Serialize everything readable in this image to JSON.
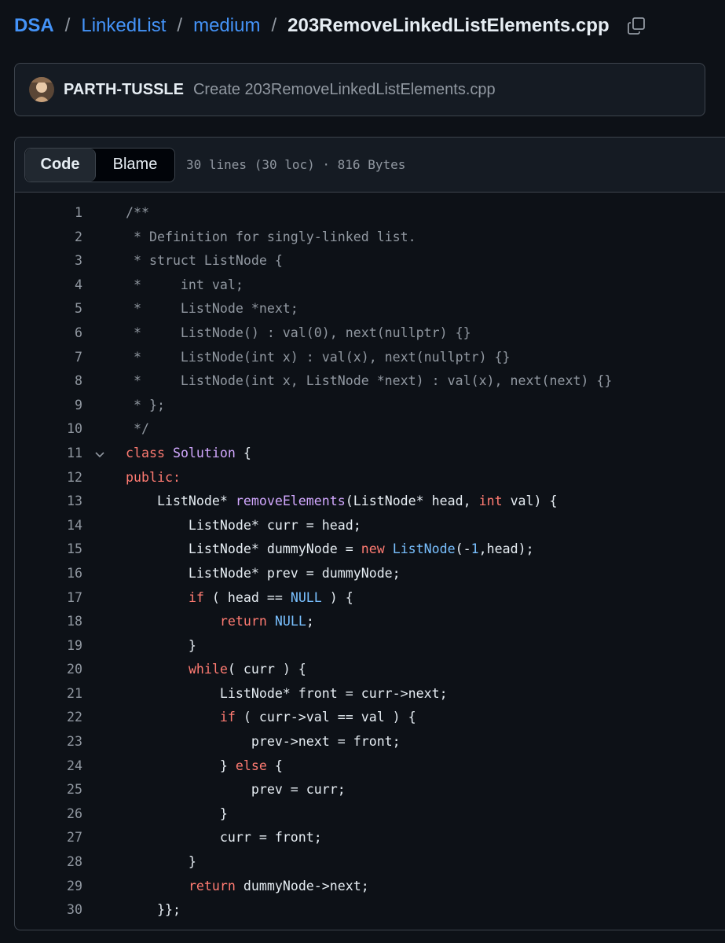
{
  "breadcrumb": {
    "repo": "DSA",
    "folder1": "LinkedList",
    "folder2": "medium",
    "file": "203RemoveLinkedListElements.cpp",
    "separator": "/"
  },
  "icons": {
    "copy": "copy-icon",
    "fold": "chevron-down-icon",
    "avatar": "user-avatar"
  },
  "commit": {
    "author": "PARTH-TUSSLE",
    "message": "Create 203RemoveLinkedListElements.cpp"
  },
  "file_header": {
    "code_tab": "Code",
    "blame_tab": "Blame",
    "stats": "30 lines (30 loc) · 816 Bytes"
  },
  "colors": {
    "background": "#0d1117",
    "link": "#4493f8",
    "comment": "#9198a1",
    "keyword": "#ff7b72",
    "function": "#d2a8ff",
    "constant": "#79c0ff"
  },
  "code": {
    "lines": [
      {
        "n": "1",
        "t": [
          [
            "c",
            "/**"
          ]
        ]
      },
      {
        "n": "2",
        "t": [
          [
            "c",
            " * Definition for singly-linked list."
          ]
        ]
      },
      {
        "n": "3",
        "t": [
          [
            "c",
            " * struct ListNode {"
          ]
        ]
      },
      {
        "n": "4",
        "t": [
          [
            "c",
            " *     int val;"
          ]
        ]
      },
      {
        "n": "5",
        "t": [
          [
            "c",
            " *     ListNode *next;"
          ]
        ]
      },
      {
        "n": "6",
        "t": [
          [
            "c",
            " *     ListNode() : val(0), next(nullptr) {}"
          ]
        ]
      },
      {
        "n": "7",
        "t": [
          [
            "c",
            " *     ListNode(int x) : val(x), next(nullptr) {}"
          ]
        ]
      },
      {
        "n": "8",
        "t": [
          [
            "c",
            " *     ListNode(int x, ListNode *next) : val(x), next(next) {}"
          ]
        ]
      },
      {
        "n": "9",
        "t": [
          [
            "c",
            " * };"
          ]
        ]
      },
      {
        "n": "10",
        "t": [
          [
            "c",
            " */"
          ]
        ]
      },
      {
        "n": "11",
        "fold": true,
        "t": [
          [
            "k",
            "class"
          ],
          [
            "p",
            " "
          ],
          [
            "f",
            "Solution"
          ],
          [
            "p",
            " {"
          ]
        ]
      },
      {
        "n": "12",
        "t": [
          [
            "k",
            "public:"
          ]
        ]
      },
      {
        "n": "13",
        "t": [
          [
            "p",
            "    ListNode* "
          ],
          [
            "f",
            "removeElements"
          ],
          [
            "p",
            "(ListNode* head, "
          ],
          [
            "k",
            "int"
          ],
          [
            "p",
            " val) {"
          ]
        ]
      },
      {
        "n": "14",
        "t": [
          [
            "p",
            "        ListNode* curr = head;"
          ]
        ]
      },
      {
        "n": "15",
        "t": [
          [
            "p",
            "        ListNode* dummyNode = "
          ],
          [
            "k",
            "new"
          ],
          [
            "p",
            " "
          ],
          [
            "y",
            "ListNode"
          ],
          [
            "p",
            "(-"
          ],
          [
            "y",
            "1"
          ],
          [
            "p",
            ",head);"
          ]
        ]
      },
      {
        "n": "16",
        "t": [
          [
            "p",
            "        ListNode* prev = dummyNode;"
          ]
        ]
      },
      {
        "n": "17",
        "t": [
          [
            "p",
            "        "
          ],
          [
            "k",
            "if"
          ],
          [
            "p",
            " ( head == "
          ],
          [
            "y",
            "NULL"
          ],
          [
            "p",
            " ) {"
          ]
        ]
      },
      {
        "n": "18",
        "t": [
          [
            "p",
            "            "
          ],
          [
            "k",
            "return"
          ],
          [
            "p",
            " "
          ],
          [
            "y",
            "NULL"
          ],
          [
            "p",
            ";"
          ]
        ]
      },
      {
        "n": "19",
        "t": [
          [
            "p",
            "        }"
          ]
        ]
      },
      {
        "n": "20",
        "t": [
          [
            "p",
            "        "
          ],
          [
            "k",
            "while"
          ],
          [
            "p",
            "( curr ) {"
          ]
        ]
      },
      {
        "n": "21",
        "t": [
          [
            "p",
            "            ListNode* front = curr->next;"
          ]
        ]
      },
      {
        "n": "22",
        "t": [
          [
            "p",
            "            "
          ],
          [
            "k",
            "if"
          ],
          [
            "p",
            " ( curr->val == val ) {"
          ]
        ]
      },
      {
        "n": "23",
        "t": [
          [
            "p",
            "                prev->next = front;"
          ]
        ]
      },
      {
        "n": "24",
        "t": [
          [
            "p",
            "            } "
          ],
          [
            "k",
            "else"
          ],
          [
            "p",
            " {"
          ]
        ]
      },
      {
        "n": "25",
        "t": [
          [
            "p",
            "                prev = curr;"
          ]
        ]
      },
      {
        "n": "26",
        "t": [
          [
            "p",
            "            }"
          ]
        ]
      },
      {
        "n": "27",
        "t": [
          [
            "p",
            "            curr = front;"
          ]
        ]
      },
      {
        "n": "28",
        "t": [
          [
            "p",
            "        }"
          ]
        ]
      },
      {
        "n": "29",
        "t": [
          [
            "p",
            "        "
          ],
          [
            "k",
            "return"
          ],
          [
            "p",
            " dummyNode->next;"
          ]
        ]
      },
      {
        "n": "30",
        "t": [
          [
            "p",
            "    }};"
          ]
        ]
      }
    ]
  }
}
